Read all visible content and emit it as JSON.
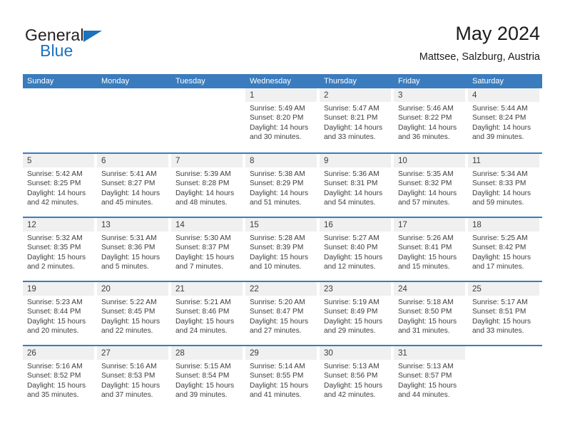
{
  "brand": {
    "name_part1": "General",
    "name_part2": "Blue",
    "triangle_color": "#1c72bd",
    "text_color": "#231f20"
  },
  "header": {
    "title": "May 2024",
    "subtitle": "Mattsee, Salzburg, Austria"
  },
  "theme": {
    "header_blue": "#3a7cbe",
    "date_band_gray": "#f0f0f0",
    "text_dark": "#3d3d3d"
  },
  "weekdays": [
    "Sunday",
    "Monday",
    "Tuesday",
    "Wednesday",
    "Thursday",
    "Friday",
    "Saturday"
  ],
  "weeks": [
    [
      {
        "day": "",
        "lines": []
      },
      {
        "day": "",
        "lines": []
      },
      {
        "day": "",
        "lines": []
      },
      {
        "day": "1",
        "lines": [
          "Sunrise: 5:49 AM",
          "Sunset: 8:20 PM",
          "Daylight: 14 hours",
          "and 30 minutes."
        ]
      },
      {
        "day": "2",
        "lines": [
          "Sunrise: 5:47 AM",
          "Sunset: 8:21 PM",
          "Daylight: 14 hours",
          "and 33 minutes."
        ]
      },
      {
        "day": "3",
        "lines": [
          "Sunrise: 5:46 AM",
          "Sunset: 8:22 PM",
          "Daylight: 14 hours",
          "and 36 minutes."
        ]
      },
      {
        "day": "4",
        "lines": [
          "Sunrise: 5:44 AM",
          "Sunset: 8:24 PM",
          "Daylight: 14 hours",
          "and 39 minutes."
        ]
      }
    ],
    [
      {
        "day": "5",
        "lines": [
          "Sunrise: 5:42 AM",
          "Sunset: 8:25 PM",
          "Daylight: 14 hours",
          "and 42 minutes."
        ]
      },
      {
        "day": "6",
        "lines": [
          "Sunrise: 5:41 AM",
          "Sunset: 8:27 PM",
          "Daylight: 14 hours",
          "and 45 minutes."
        ]
      },
      {
        "day": "7",
        "lines": [
          "Sunrise: 5:39 AM",
          "Sunset: 8:28 PM",
          "Daylight: 14 hours",
          "and 48 minutes."
        ]
      },
      {
        "day": "8",
        "lines": [
          "Sunrise: 5:38 AM",
          "Sunset: 8:29 PM",
          "Daylight: 14 hours",
          "and 51 minutes."
        ]
      },
      {
        "day": "9",
        "lines": [
          "Sunrise: 5:36 AM",
          "Sunset: 8:31 PM",
          "Daylight: 14 hours",
          "and 54 minutes."
        ]
      },
      {
        "day": "10",
        "lines": [
          "Sunrise: 5:35 AM",
          "Sunset: 8:32 PM",
          "Daylight: 14 hours",
          "and 57 minutes."
        ]
      },
      {
        "day": "11",
        "lines": [
          "Sunrise: 5:34 AM",
          "Sunset: 8:33 PM",
          "Daylight: 14 hours",
          "and 59 minutes."
        ]
      }
    ],
    [
      {
        "day": "12",
        "lines": [
          "Sunrise: 5:32 AM",
          "Sunset: 8:35 PM",
          "Daylight: 15 hours",
          "and 2 minutes."
        ]
      },
      {
        "day": "13",
        "lines": [
          "Sunrise: 5:31 AM",
          "Sunset: 8:36 PM",
          "Daylight: 15 hours",
          "and 5 minutes."
        ]
      },
      {
        "day": "14",
        "lines": [
          "Sunrise: 5:30 AM",
          "Sunset: 8:37 PM",
          "Daylight: 15 hours",
          "and 7 minutes."
        ]
      },
      {
        "day": "15",
        "lines": [
          "Sunrise: 5:28 AM",
          "Sunset: 8:39 PM",
          "Daylight: 15 hours",
          "and 10 minutes."
        ]
      },
      {
        "day": "16",
        "lines": [
          "Sunrise: 5:27 AM",
          "Sunset: 8:40 PM",
          "Daylight: 15 hours",
          "and 12 minutes."
        ]
      },
      {
        "day": "17",
        "lines": [
          "Sunrise: 5:26 AM",
          "Sunset: 8:41 PM",
          "Daylight: 15 hours",
          "and 15 minutes."
        ]
      },
      {
        "day": "18",
        "lines": [
          "Sunrise: 5:25 AM",
          "Sunset: 8:42 PM",
          "Daylight: 15 hours",
          "and 17 minutes."
        ]
      }
    ],
    [
      {
        "day": "19",
        "lines": [
          "Sunrise: 5:23 AM",
          "Sunset: 8:44 PM",
          "Daylight: 15 hours",
          "and 20 minutes."
        ]
      },
      {
        "day": "20",
        "lines": [
          "Sunrise: 5:22 AM",
          "Sunset: 8:45 PM",
          "Daylight: 15 hours",
          "and 22 minutes."
        ]
      },
      {
        "day": "21",
        "lines": [
          "Sunrise: 5:21 AM",
          "Sunset: 8:46 PM",
          "Daylight: 15 hours",
          "and 24 minutes."
        ]
      },
      {
        "day": "22",
        "lines": [
          "Sunrise: 5:20 AM",
          "Sunset: 8:47 PM",
          "Daylight: 15 hours",
          "and 27 minutes."
        ]
      },
      {
        "day": "23",
        "lines": [
          "Sunrise: 5:19 AM",
          "Sunset: 8:49 PM",
          "Daylight: 15 hours",
          "and 29 minutes."
        ]
      },
      {
        "day": "24",
        "lines": [
          "Sunrise: 5:18 AM",
          "Sunset: 8:50 PM",
          "Daylight: 15 hours",
          "and 31 minutes."
        ]
      },
      {
        "day": "25",
        "lines": [
          "Sunrise: 5:17 AM",
          "Sunset: 8:51 PM",
          "Daylight: 15 hours",
          "and 33 minutes."
        ]
      }
    ],
    [
      {
        "day": "26",
        "lines": [
          "Sunrise: 5:16 AM",
          "Sunset: 8:52 PM",
          "Daylight: 15 hours",
          "and 35 minutes."
        ]
      },
      {
        "day": "27",
        "lines": [
          "Sunrise: 5:16 AM",
          "Sunset: 8:53 PM",
          "Daylight: 15 hours",
          "and 37 minutes."
        ]
      },
      {
        "day": "28",
        "lines": [
          "Sunrise: 5:15 AM",
          "Sunset: 8:54 PM",
          "Daylight: 15 hours",
          "and 39 minutes."
        ]
      },
      {
        "day": "29",
        "lines": [
          "Sunrise: 5:14 AM",
          "Sunset: 8:55 PM",
          "Daylight: 15 hours",
          "and 41 minutes."
        ]
      },
      {
        "day": "30",
        "lines": [
          "Sunrise: 5:13 AM",
          "Sunset: 8:56 PM",
          "Daylight: 15 hours",
          "and 42 minutes."
        ]
      },
      {
        "day": "31",
        "lines": [
          "Sunrise: 5:13 AM",
          "Sunset: 8:57 PM",
          "Daylight: 15 hours",
          "and 44 minutes."
        ]
      },
      {
        "day": "",
        "lines": []
      }
    ]
  ]
}
